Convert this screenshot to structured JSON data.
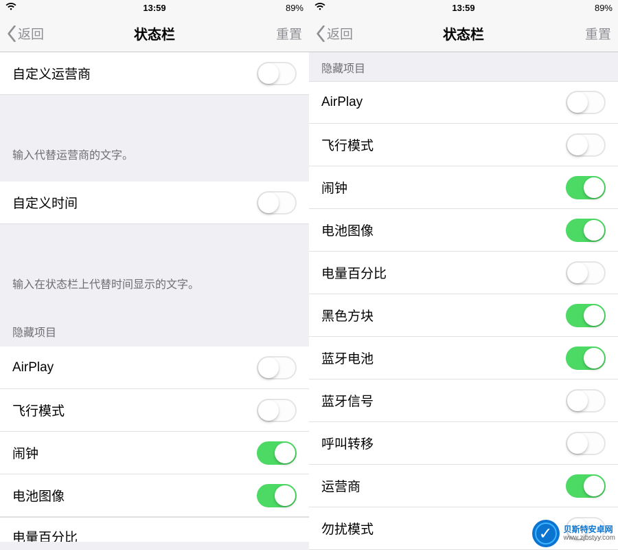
{
  "status": {
    "time": "13:59",
    "battery": "89%"
  },
  "nav": {
    "back": "返回",
    "title": "状态栏",
    "reset": "重置"
  },
  "left": {
    "cells": [
      {
        "label": "自定义运营商",
        "on": false
      }
    ],
    "footer1": "输入代替运营商的文字。",
    "cells2": [
      {
        "label": "自定义时间",
        "on": false
      }
    ],
    "footer2": "输入在状态栏上代替时间显示的文字。",
    "hideHeader": "隐藏项目",
    "hideItems": [
      {
        "label": "AirPlay",
        "on": false
      },
      {
        "label": "飞行模式",
        "on": false
      },
      {
        "label": "闹钟",
        "on": true
      },
      {
        "label": "电池图像",
        "on": true
      }
    ],
    "partial": "电量百分比"
  },
  "right": {
    "hideHeader": "隐藏项目",
    "hideItems": [
      {
        "label": "AirPlay",
        "on": false
      },
      {
        "label": "飞行模式",
        "on": false
      },
      {
        "label": "闹钟",
        "on": true
      },
      {
        "label": "电池图像",
        "on": true
      },
      {
        "label": "电量百分比",
        "on": false
      },
      {
        "label": "黑色方块",
        "on": true
      },
      {
        "label": "蓝牙电池",
        "on": true
      },
      {
        "label": "蓝牙信号",
        "on": false
      },
      {
        "label": "呼叫转移",
        "on": false
      },
      {
        "label": "运营商",
        "on": true
      },
      {
        "label": "勿扰模式",
        "on": false
      }
    ]
  },
  "watermark": {
    "brand": "贝斯特安卓网",
    "url": "www.zjbstyy.com"
  }
}
